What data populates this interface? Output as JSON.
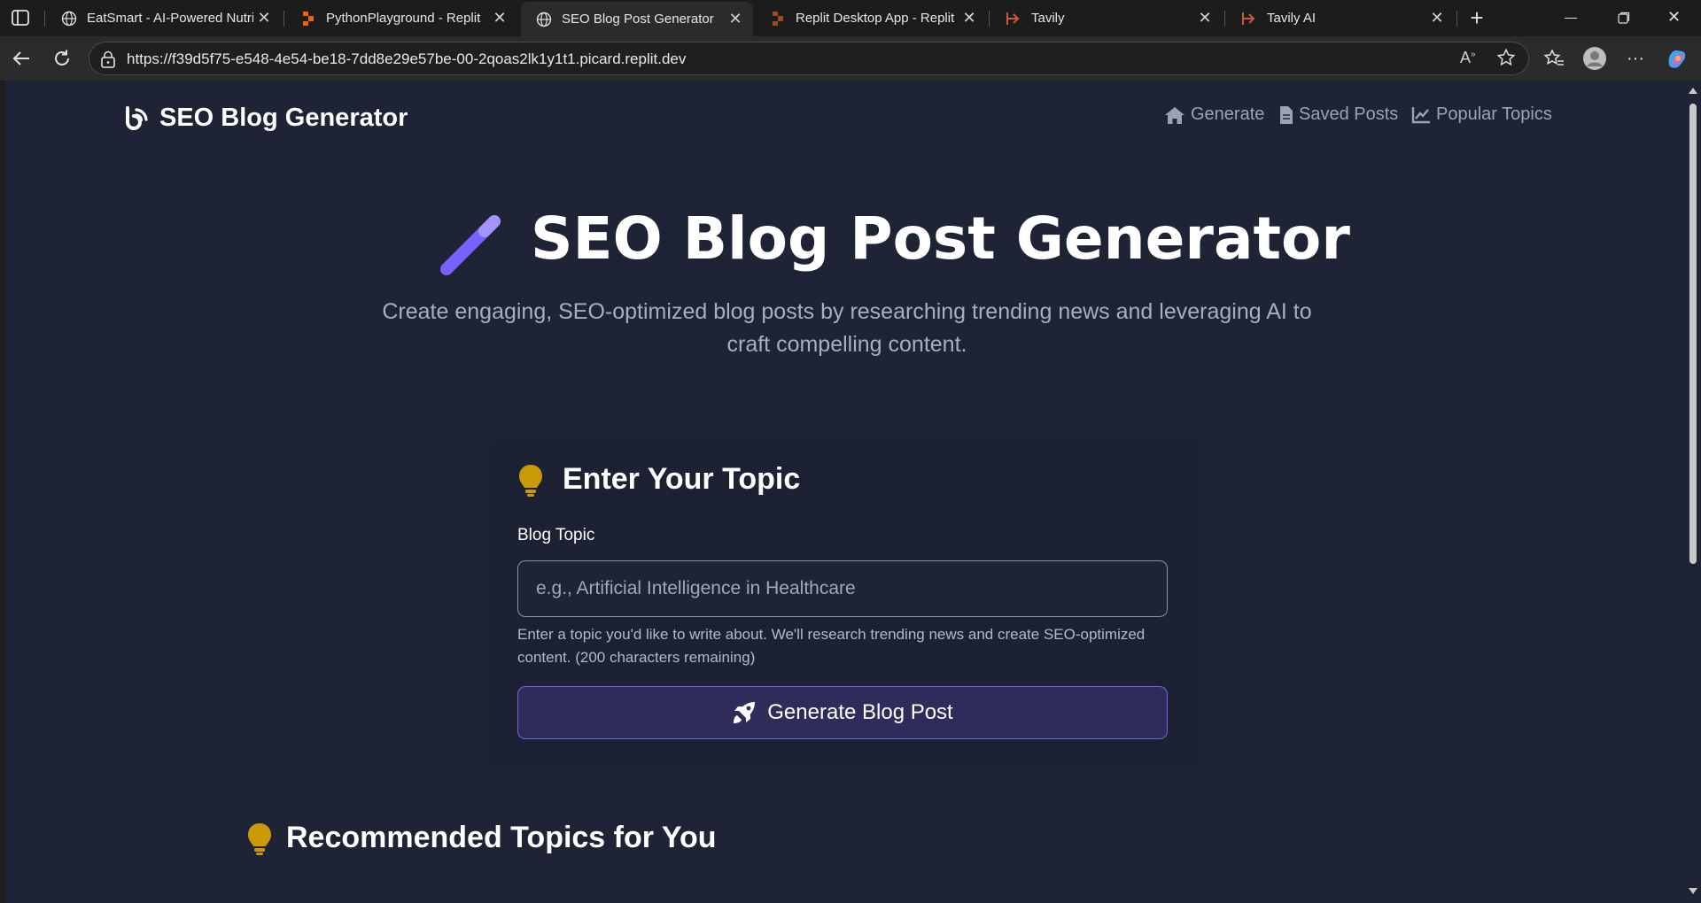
{
  "browser": {
    "tabs": [
      {
        "title": "EatSmart - AI-Powered Nutri",
        "icon": "globe-icon",
        "active": false
      },
      {
        "title": "PythonPlayground - Replit",
        "icon": "replit-icon",
        "active": false
      },
      {
        "title": "SEO Blog Post Generator",
        "icon": "globe-icon",
        "active": true
      },
      {
        "title": "Replit Desktop App - Replit",
        "icon": "replit-icon",
        "active": false
      },
      {
        "title": "Tavily",
        "icon": "tavily-icon",
        "active": false
      },
      {
        "title": "Tavily AI",
        "icon": "tavily-icon",
        "active": false
      }
    ],
    "url": "https://f39d5f75-e548-4e54-be18-7dd8e29e57be-00-2qoas2lk1y1t1.picard.replit.dev"
  },
  "navbar": {
    "brand": "SEO Blog Generator",
    "links": [
      {
        "label": "Generate",
        "icon": "home-icon"
      },
      {
        "label": "Saved Posts",
        "icon": "file-icon"
      },
      {
        "label": "Popular Topics",
        "icon": "chart-line-icon"
      }
    ]
  },
  "hero": {
    "title": "SEO Blog Post Generator",
    "subtitle": "Create engaging, SEO-optimized blog posts by researching trending news and leveraging AI to craft compelling content."
  },
  "form": {
    "heading": "Enter Your Topic",
    "label": "Blog Topic",
    "placeholder": "e.g., Artificial Intelligence in Healthcare",
    "value": "",
    "help": "Enter a topic you'd like to write about. We'll research trending news and create SEO-optimized content. (200 characters remaining)",
    "button": "Generate Blog Post"
  },
  "recommended": {
    "heading": "Recommended Topics for You"
  },
  "colors": {
    "page_bg": "#1e2436",
    "accent": "#7b61ff",
    "bulb": "#c99a06",
    "button_bg": "#2f2c5c"
  }
}
